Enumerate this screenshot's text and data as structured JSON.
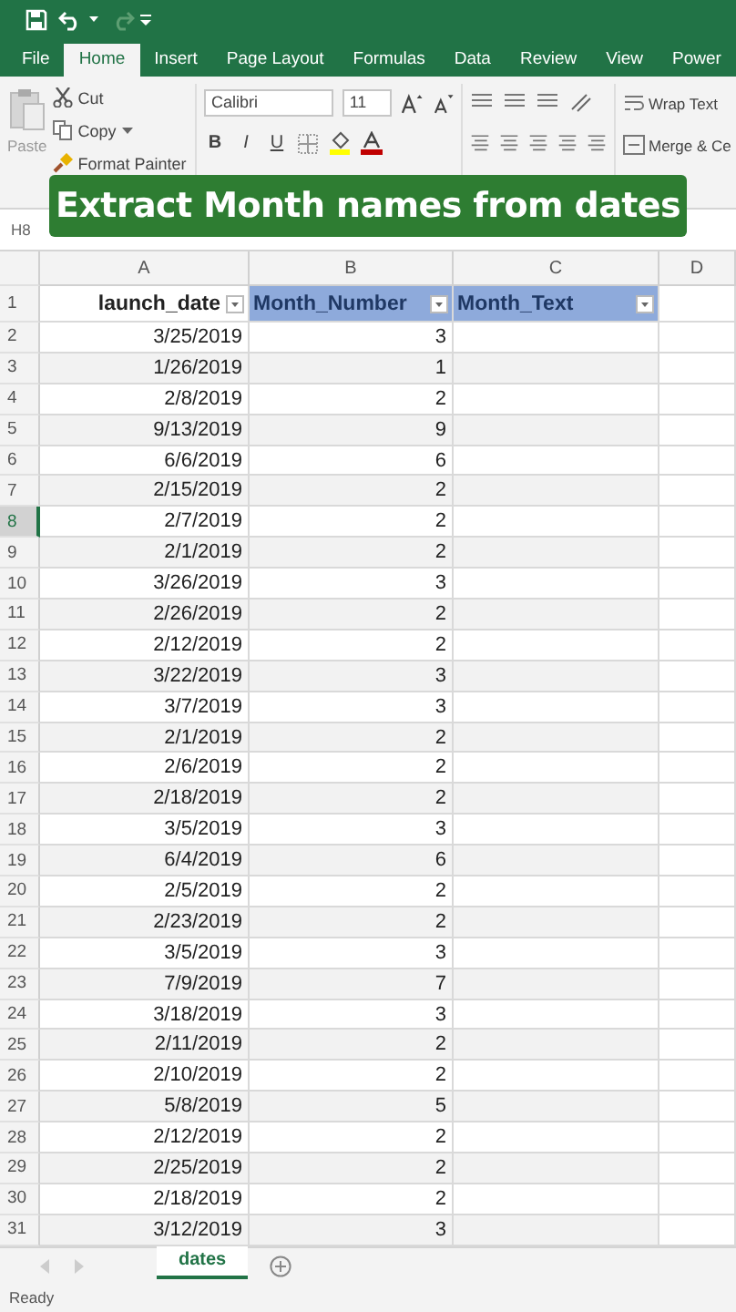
{
  "tabs": [
    {
      "label": "File",
      "selected": false
    },
    {
      "label": "Home",
      "selected": true
    },
    {
      "label": "Insert",
      "selected": false
    },
    {
      "label": "Page Layout",
      "selected": false
    },
    {
      "label": "Formulas",
      "selected": false
    },
    {
      "label": "Data",
      "selected": false
    },
    {
      "label": "Review",
      "selected": false
    },
    {
      "label": "View",
      "selected": false
    },
    {
      "label": "Power",
      "selected": false
    }
  ],
  "clipboard": {
    "paste": "Paste",
    "cut": "Cut",
    "copy": "Copy",
    "format_painter": "Format Painter"
  },
  "font": {
    "name": "Calibri",
    "size": "11",
    "bold": "B",
    "italic": "I",
    "underline": "U"
  },
  "alignment": {
    "wrap_text": "Wrap Text",
    "merge": "Merge & Ce"
  },
  "name_box": "H8",
  "banner": "Extract Month names from dates",
  "columns": [
    "A",
    "B",
    "C",
    "D"
  ],
  "header_row": {
    "row": "1",
    "cells": [
      {
        "text": "launch_date",
        "color": "#ffffff"
      },
      {
        "text": "Month_Number",
        "color": "#8eaadb"
      },
      {
        "text": "Month_Text",
        "color": "#8eaadb"
      }
    ]
  },
  "rows": [
    {
      "row": "2",
      "date": "3/25/2019",
      "month": "3",
      "selected": false
    },
    {
      "row": "3",
      "date": "1/26/2019",
      "month": "1",
      "selected": false
    },
    {
      "row": "4",
      "date": "2/8/2019",
      "month": "2",
      "selected": false
    },
    {
      "row": "5",
      "date": "9/13/2019",
      "month": "9",
      "selected": false
    },
    {
      "row": "6",
      "date": "6/6/2019",
      "month": "6",
      "selected": false
    },
    {
      "row": "7",
      "date": "2/15/2019",
      "month": "2",
      "selected": false
    },
    {
      "row": "8",
      "date": "2/7/2019",
      "month": "2",
      "selected": true
    },
    {
      "row": "9",
      "date": "2/1/2019",
      "month": "2",
      "selected": false
    },
    {
      "row": "10",
      "date": "3/26/2019",
      "month": "3",
      "selected": false
    },
    {
      "row": "11",
      "date": "2/26/2019",
      "month": "2",
      "selected": false
    },
    {
      "row": "12",
      "date": "2/12/2019",
      "month": "2",
      "selected": false
    },
    {
      "row": "13",
      "date": "3/22/2019",
      "month": "3",
      "selected": false
    },
    {
      "row": "14",
      "date": "3/7/2019",
      "month": "3",
      "selected": false
    },
    {
      "row": "15",
      "date": "2/1/2019",
      "month": "2",
      "selected": false
    },
    {
      "row": "16",
      "date": "2/6/2019",
      "month": "2",
      "selected": false
    },
    {
      "row": "17",
      "date": "2/18/2019",
      "month": "2",
      "selected": false
    },
    {
      "row": "18",
      "date": "3/5/2019",
      "month": "3",
      "selected": false
    },
    {
      "row": "19",
      "date": "6/4/2019",
      "month": "6",
      "selected": false
    },
    {
      "row": "20",
      "date": "2/5/2019",
      "month": "2",
      "selected": false
    },
    {
      "row": "21",
      "date": "2/23/2019",
      "month": "2",
      "selected": false
    },
    {
      "row": "22",
      "date": "3/5/2019",
      "month": "3",
      "selected": false
    },
    {
      "row": "23",
      "date": "7/9/2019",
      "month": "7",
      "selected": false
    },
    {
      "row": "24",
      "date": "3/18/2019",
      "month": "3",
      "selected": false
    },
    {
      "row": "25",
      "date": "2/11/2019",
      "month": "2",
      "selected": false
    },
    {
      "row": "26",
      "date": "2/10/2019",
      "month": "2",
      "selected": false
    },
    {
      "row": "27",
      "date": "5/8/2019",
      "month": "5",
      "selected": false
    },
    {
      "row": "28",
      "date": "2/12/2019",
      "month": "2",
      "selected": false
    },
    {
      "row": "29",
      "date": "2/25/2019",
      "month": "2",
      "selected": false
    },
    {
      "row": "30",
      "date": "2/18/2019",
      "month": "2",
      "selected": false
    },
    {
      "row": "31",
      "date": "3/12/2019",
      "month": "3",
      "selected": false
    }
  ],
  "sheet_tabs": [
    {
      "label": "dates",
      "selected": true
    }
  ],
  "status": "Ready"
}
